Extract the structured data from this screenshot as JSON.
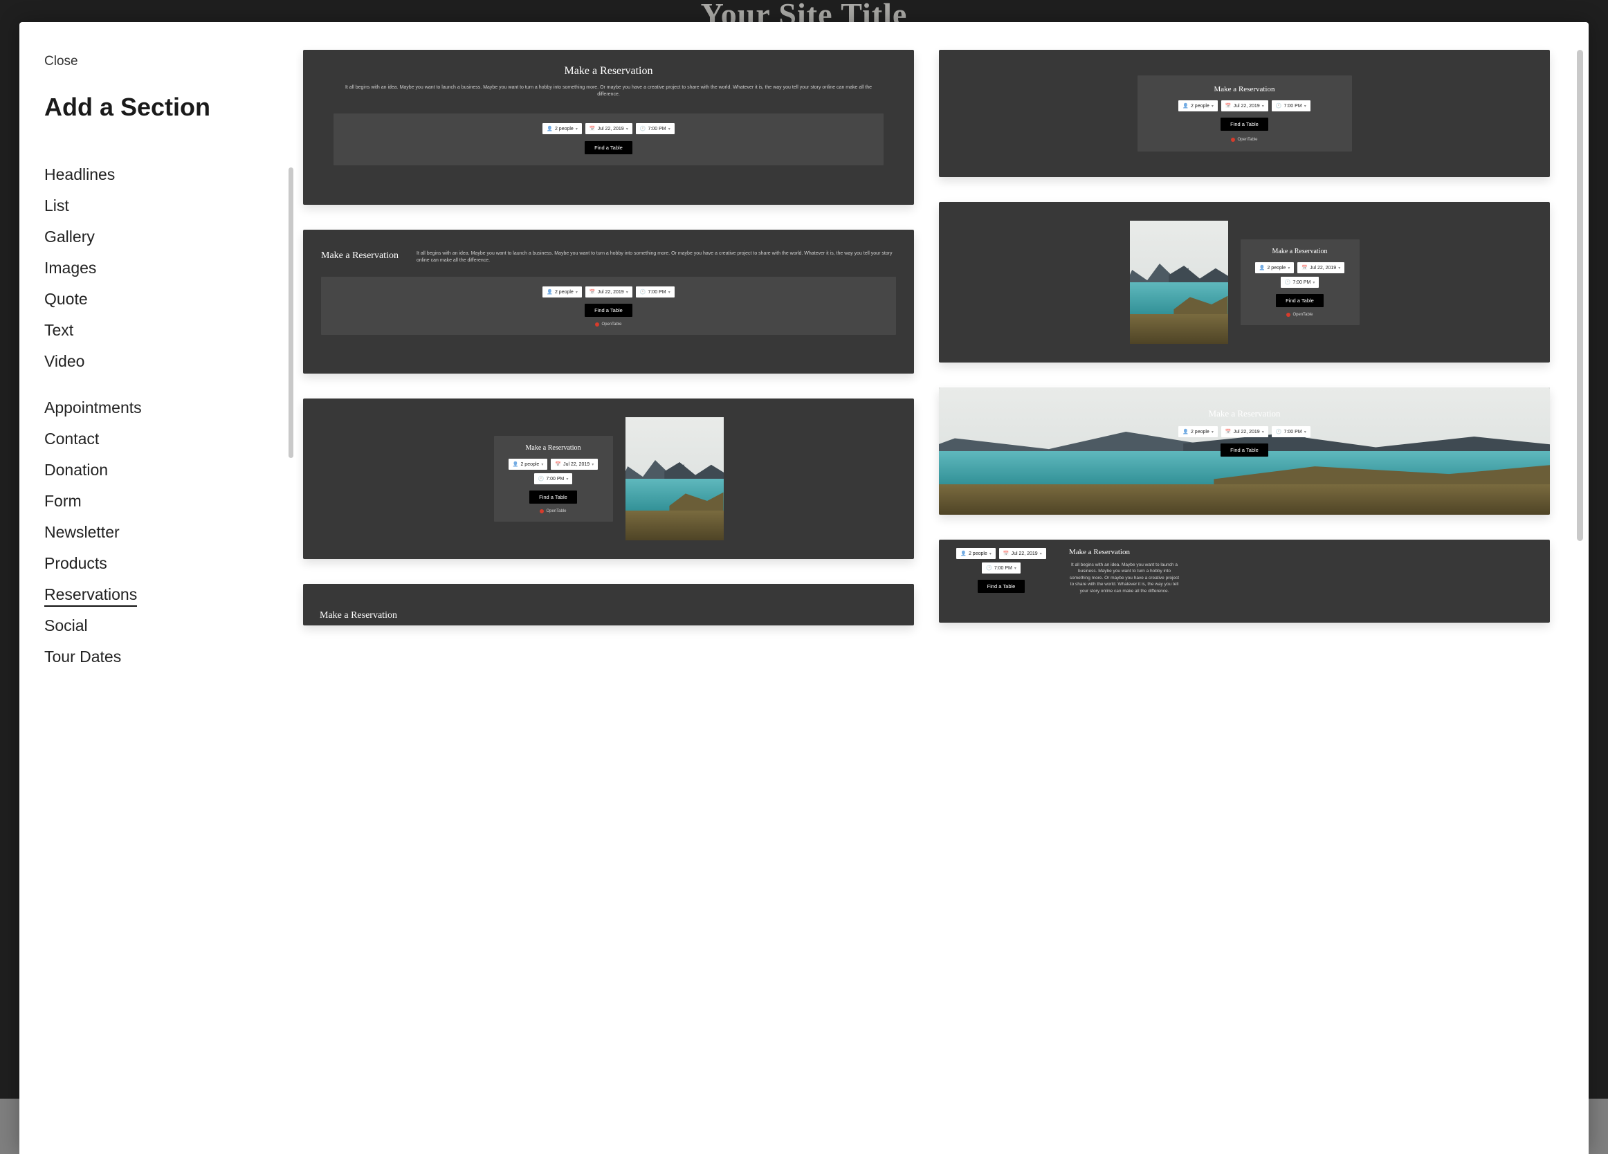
{
  "background_title": "Your Site Title",
  "modal": {
    "close": "Close",
    "heading": "Add a Section"
  },
  "categories_group1": [
    "Headlines",
    "List",
    "Gallery",
    "Images",
    "Quote",
    "Text",
    "Video"
  ],
  "categories_group2": [
    "Appointments",
    "Contact",
    "Donation",
    "Form",
    "Newsletter",
    "Products",
    "Reservations",
    "Social",
    "Tour Dates"
  ],
  "active_category": "Reservations",
  "widget": {
    "title": "Make a Reservation",
    "desc_long": "It all begins with an idea. Maybe you want to launch a business. Maybe you want to turn a hobby into something more. Or maybe you have a creative project to share with the world. Whatever it is, the way you tell your story online can make all the difference.",
    "people": "2 people",
    "date": "Jul 22, 2019",
    "time": "7:00 PM",
    "button": "Find a Table",
    "provider": "OpenTable"
  }
}
